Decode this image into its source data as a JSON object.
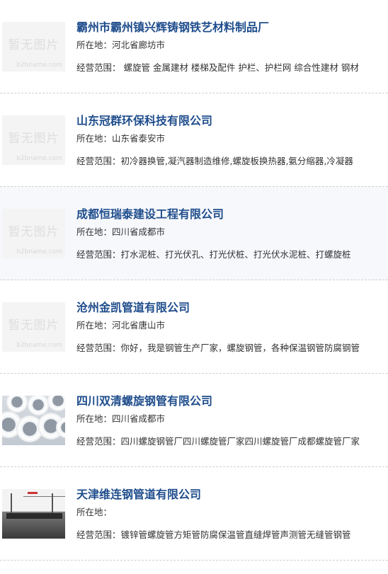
{
  "placeholder": {
    "text": "暂无图片",
    "watermark": "b2bname.com"
  },
  "companies": [
    {
      "name": "霸州市霸州镇兴辉铸钢铁艺材料制品厂",
      "location_label": "所在地：",
      "location": "河北省廊坊市",
      "scope_label": "经营范围：",
      "scope": " 螺旋管 金属建材 楼梯及配件 护栏、护栏网 综合性建材 钢材",
      "image": "placeholder"
    },
    {
      "name": "山东冠群环保科技有限公司",
      "location_label": "所在地：",
      "location": "山东省泰安市",
      "scope_label": "经营范围：",
      "scope": "初冷器换管,凝汽器制造维修,螺旋板换热器,氨分缩器,冷凝器",
      "image": "placeholder"
    },
    {
      "name": "成都恒瑞泰建设工程有限公司",
      "location_label": "所在地：",
      "location": "四川省成都市",
      "scope_label": "经营范围：",
      "scope": "打水泥桩、打光伏孔、打光伏桩、打光伏水泥桩、打螺旋桩",
      "image": "placeholder"
    },
    {
      "name": "沧州金凯管道有限公司",
      "location_label": "所在地：",
      "location": "河北省唐山市",
      "scope_label": "经营范围：",
      "scope": "你好，我是钢管生产厂家，螺旋钢管，各种保温钢管防腐钢管",
      "image": "placeholder"
    },
    {
      "name": "四川双清螺旋钢管有限公司",
      "location_label": "所在地：",
      "location": "四川省成都市",
      "scope_label": "经营范围：",
      "scope": "四川螺旋钢管厂四川螺旋管厂家四川螺旋管厂成都螺旋管厂家",
      "image": "pipes"
    },
    {
      "name": "天津维连钢管道有限公司",
      "location_label": "所在地：",
      "location": "",
      "scope_label": "经营范围：",
      "scope": "镀锌管螺旋管方矩管防腐保温管直缝焊管声测管无缝管钢管",
      "image": "factory"
    }
  ]
}
